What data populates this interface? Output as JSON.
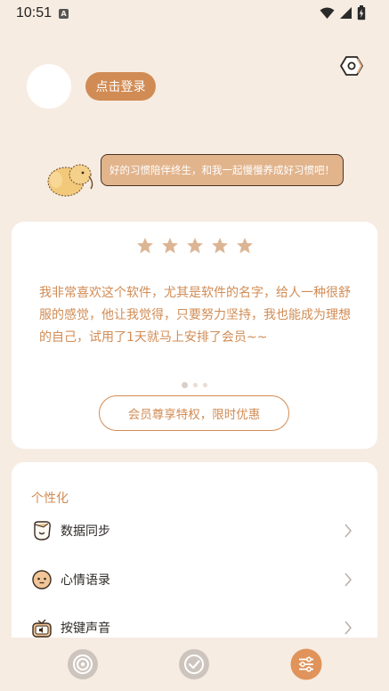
{
  "status_bar": {
    "time": "10:51",
    "notification_letter": "A"
  },
  "profile": {
    "login_label": "点击登录"
  },
  "mascot": {
    "speech": "好的习惯陪伴终生，和我一起慢慢养成好习惯吧！"
  },
  "review": {
    "rating": 5,
    "text": "我非常喜欢这个软件，尤其是软件的名字，给人一种很舒服的感觉，他让我觉得，只要努力坚持，我也能成为理想的自己，试用了1天就马上安排了会员~~",
    "carousel_pages": 3,
    "carousel_active": 1,
    "member_button": "会员尊享特权，限时优惠"
  },
  "settings": {
    "section_title": "个性化",
    "items": [
      {
        "label": "数据同步",
        "icon": "data-sync-icon"
      },
      {
        "label": "心情语录",
        "icon": "mood-face-icon"
      },
      {
        "label": "按键声音",
        "icon": "key-sound-tv-icon"
      }
    ]
  },
  "bottom_nav": {
    "items": [
      {
        "icon": "focus-target-icon",
        "active": false
      },
      {
        "icon": "check-circle-icon",
        "active": false
      },
      {
        "icon": "settings-sliders-icon",
        "active": true
      }
    ]
  },
  "colors": {
    "background": "#f7ece2",
    "accent": "#d18c55",
    "star": "#dcb594",
    "bubble": "#e2b48c",
    "nav_inactive": "#cdc5bd"
  }
}
